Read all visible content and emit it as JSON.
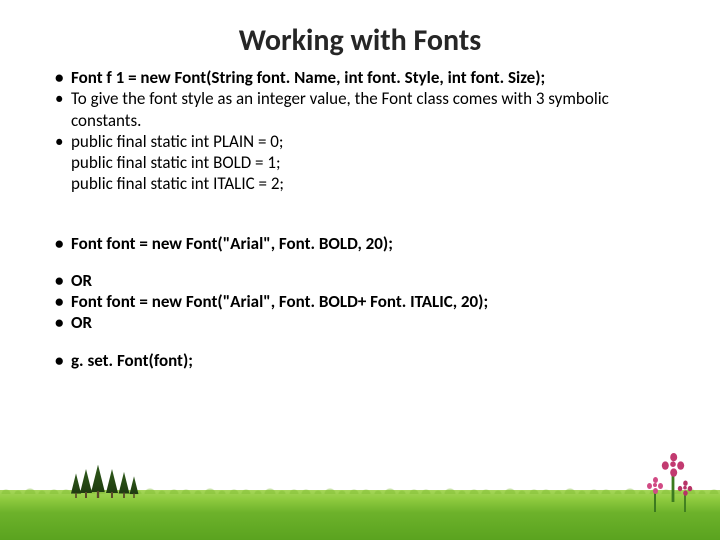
{
  "title": "Working with Fonts",
  "bullets": {
    "b1": "Font f 1 = new Font(String font. Name, int font. Style, int font. Size);",
    "b2": "To give the font style as an integer value, the Font class comes with 3 symbolic constants.",
    "b3_l1": "public final static int PLAIN = 0;",
    "b3_l2": "public final static int BOLD = 1;",
    "b3_l3": "public final static int ITALIC = 2;",
    "b4": "Font font = new Font(\"Arial\", Font. BOLD, 20);",
    "b5": "OR",
    "b6": "Font font = new Font(\"Arial\", Font. BOLD+ Font. ITALIC, 20);",
    "b7": "OR",
    "b8": "g. set. Font(font);"
  }
}
